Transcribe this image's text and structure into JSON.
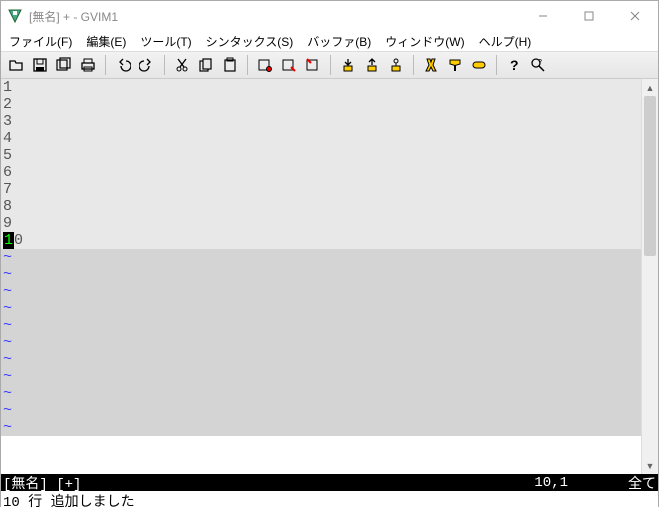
{
  "title": "[無名] + - GVIM1",
  "menu": {
    "file": "ファイル(F)",
    "edit": "編集(E)",
    "tool": "ツール(T)",
    "syntax": "シンタックス(S)",
    "buffer": "バッファ(B)",
    "window": "ウィンドウ(W)",
    "help": "ヘルプ(H)"
  },
  "buffer": {
    "lines": [
      "1",
      "2",
      "3",
      "4",
      "5",
      "6",
      "7",
      "8",
      "9"
    ],
    "cursor_line_before": "1",
    "cursor_cell": "0",
    "empty_marker": "~",
    "empty_count": 11
  },
  "status": {
    "left": "[無名] [+]",
    "pos": "10,1",
    "right": "全て"
  },
  "cmdline": "10 行 追加しました"
}
